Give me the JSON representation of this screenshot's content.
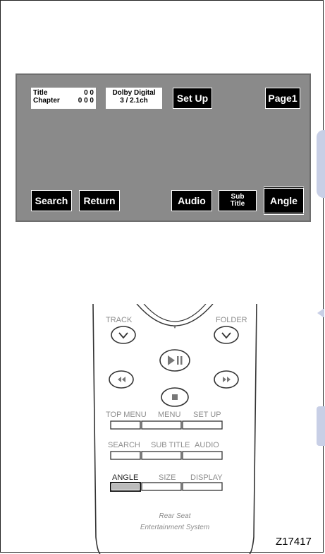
{
  "screen": {
    "title_label": "Title",
    "title_value": "0 0",
    "chapter_label": "Chapter",
    "chapter_value": "0 0 0",
    "audio_format": "Dolby Digital",
    "audio_channels": "3 / 2.1ch",
    "setup_button": "Set Up",
    "page_button": "Page1",
    "search_button": "Search",
    "return_button": "Return",
    "audio_button": "Audio",
    "subtitle_button_line1": "Sub",
    "subtitle_button_line2": "Title",
    "angle_button": "Angle"
  },
  "remote": {
    "track_label": "TRACK",
    "folder_label": "FOLDER",
    "top_menu_label": "TOP MENU",
    "menu_label": "MENU",
    "set_up_label": "SET UP",
    "search_label": "SEARCH",
    "subtitle_label": "SUB TITLE",
    "audio_label": "AUDIO",
    "angle_label": "ANGLE",
    "size_label": "SIZE",
    "display_label": "DISPLAY",
    "system_line1": "Rear Seat",
    "system_line2": "Entertainment System"
  },
  "figure_code": "Z17417",
  "colors": {
    "screen_bg": "#8a8a8a",
    "button_bg": "#000000",
    "remote_text": "#8c8c8c",
    "side_accent": "#c8cfe6"
  }
}
